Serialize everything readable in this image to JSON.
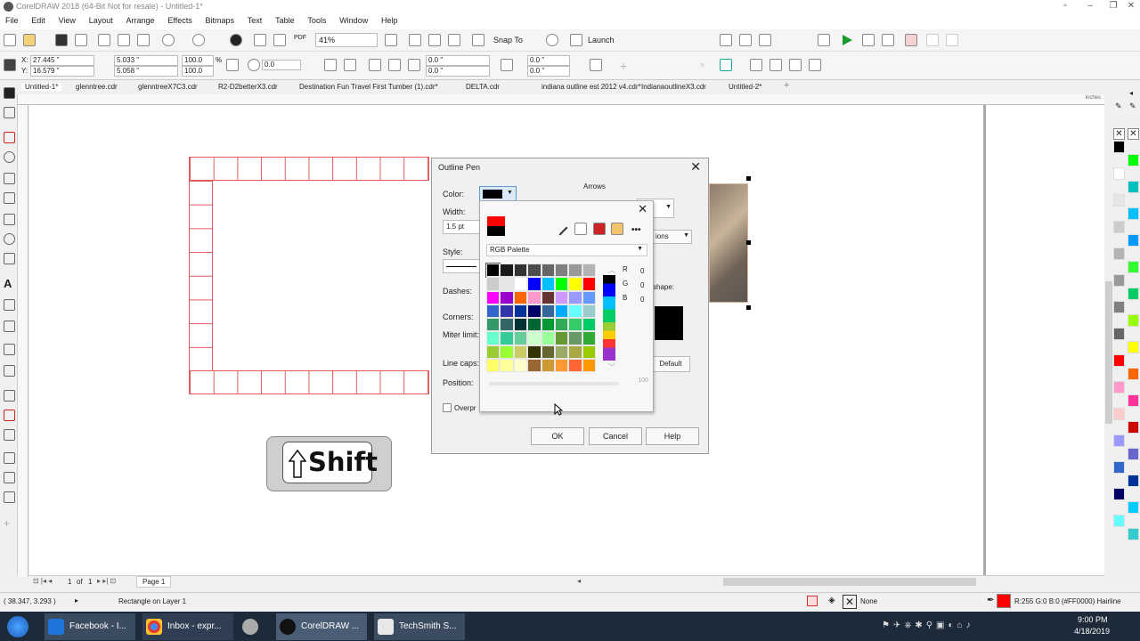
{
  "window": {
    "title": "CorelDRAW 2018 (64-Bit Not for resale) - Untitled-1*"
  },
  "menu": [
    "File",
    "Edit",
    "View",
    "Layout",
    "Arrange",
    "Effects",
    "Bitmaps",
    "Text",
    "Table",
    "Tools",
    "Window",
    "Help"
  ],
  "toolbar": {
    "zoom": "41%",
    "snap_to": "Snap To",
    "launch": "Launch",
    "pdf": "PDF"
  },
  "propertybar": {
    "x": "27.445 \"",
    "y": "16.579 \"",
    "w": "5.033 \"",
    "h": "5.058 \"",
    "scale_w": "100.0",
    "scale_h": "100.0",
    "pct": "%",
    "angle": "0.0",
    "corner1": "0.0 \"",
    "corner2": "0.0 \"",
    "corner3": "0.0 \"",
    "corner4": "0.0 \""
  },
  "doc_tabs": [
    "Untitled-1*",
    "glenntree.cdr",
    "glenntreeX7C3.cdr",
    "R2-D2betterX3.cdr",
    "Destination Fun Travel First Tumber (1).cdr*",
    "DELTA.cdr",
    "indiana outline est 2012 v4.cdr*",
    "IndianaoutlineX3.cdr",
    "Untitled-2*"
  ],
  "ruler": {
    "units": "inches"
  },
  "shift_key": {
    "label": "Shift"
  },
  "dialog": {
    "title": "Outline Pen",
    "color_label": "Color:",
    "width_label": "Width:",
    "width_value": "1.5 pt",
    "style_label": "Style:",
    "dashes_label": "Dashes:",
    "corners_label": "Corners:",
    "miter_label": "Miter limit:",
    "linecaps_label": "Line caps:",
    "position_label": "Position:",
    "arrows_label": "Arrows",
    "options_label": "ions",
    "shape_label": "shape:",
    "default_label": "Default",
    "overprint_label": "Overpr",
    "ok": "OK",
    "cancel": "Cancel",
    "help": "Help"
  },
  "color_popup": {
    "palette_name": "RGB Palette",
    "r_label": "R",
    "g_label": "G",
    "b_label": "B",
    "r": "0",
    "g": "0",
    "b": "0",
    "position_value": "100",
    "swatches": [
      "#000000",
      "#1a1a1a",
      "#333333",
      "#4d4d4d",
      "#666666",
      "#808080",
      "#999999",
      "#b3b3b3",
      "#cccccc",
      "#e6e6e6",
      "#ffffff",
      "#0000ff",
      "#00bfff",
      "#00ff00",
      "#ffff00",
      "#ff0000",
      "#ff00ff",
      "#9900cc",
      "#ff6600",
      "#ff99cc",
      "#663333",
      "#cc99ff",
      "#9999ff",
      "#6699ff",
      "#3366cc",
      "#3333aa",
      "#003399",
      "#000066",
      "#336699",
      "#00aaff",
      "#66ffff",
      "#99cccc",
      "#339966",
      "#336666",
      "#003333",
      "#006633",
      "#009933",
      "#33aa55",
      "#33cc66",
      "#00cc66",
      "#66ffcc",
      "#33cc99",
      "#66cc99",
      "#ccffcc",
      "#99ff99",
      "#669933",
      "#669966",
      "#33aa33",
      "#99cc33",
      "#99ff33",
      "#cccc66",
      "#333300",
      "#666633",
      "#99aa66",
      "#aaaa44",
      "#99cc00",
      "#ffff66",
      "#ffff99",
      "#ffffcc",
      "#996633",
      "#cc9933",
      "#ff9933",
      "#ff6633",
      "#ff9900"
    ]
  },
  "right_palette": [
    "#000000",
    "#00ff00",
    "#ffffff",
    "#00bfbf",
    "#e6e6e6",
    "#00bfff",
    "#cccccc",
    "#0099ff",
    "#b3b3b3",
    "#33ff33",
    "#999999",
    "#00cc66",
    "#808080",
    "#99ff00",
    "#666666",
    "#ffff00",
    "#ff0000",
    "#ff6600",
    "#ff99cc",
    "#ff3399",
    "#ffcccc",
    "#cc0000",
    "#9999ff",
    "#6666cc",
    "#3366cc",
    "#003399",
    "#000066",
    "#00ccff",
    "#66ffff",
    "#33cccc"
  ],
  "page_nav": {
    "current": "1",
    "of": "of",
    "total": "1",
    "page_tab": "Page 1"
  },
  "status": {
    "coords": "( 38.347, 3.293 )",
    "object": "Rectangle on Layer 1",
    "fill": "None",
    "outline": "R:255 G:0 B:0 (#FF0000)  Hairline"
  },
  "taskbar": {
    "items": [
      "Facebook - I...",
      "Inbox - expr...",
      "CorelDRAW ...",
      "TechSmith S..."
    ],
    "time": "9:00 PM",
    "date": "4/18/2019"
  }
}
